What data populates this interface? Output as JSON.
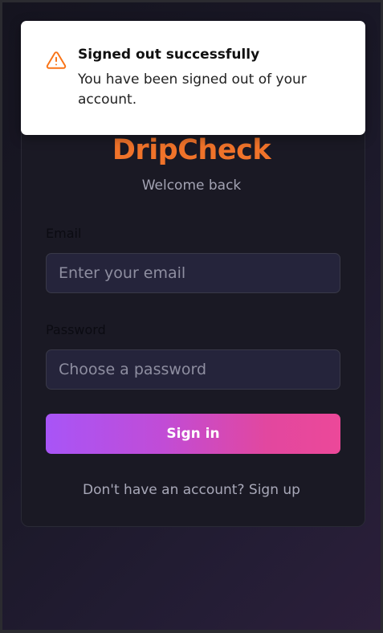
{
  "toast": {
    "icon": "warning-triangle-icon",
    "title": "Signed out successfully",
    "message": "You have been signed out of your account.",
    "accent_color": "#f97316"
  },
  "brand": {
    "name": "DripCheck",
    "color": "#f0732a"
  },
  "subtitle": "Welcome back",
  "form": {
    "email_label": "Email",
    "email_placeholder": "Enter your email",
    "email_value": "",
    "password_label": "Password",
    "password_placeholder": "Choose a password",
    "password_value": "",
    "submit_label": "Sign in",
    "submit_gradient": [
      "#a855f7",
      "#ec4899"
    ]
  },
  "footer": {
    "prompt": "Don't have an account?",
    "link_label": "Sign up"
  }
}
